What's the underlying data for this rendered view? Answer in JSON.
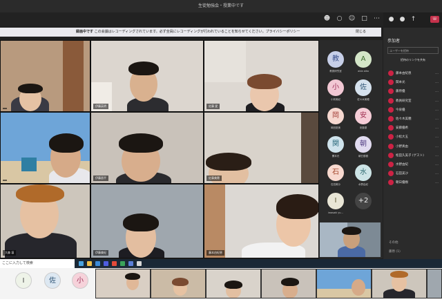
{
  "window": {
    "title": "生徒勉強会・授業中です"
  },
  "banner": {
    "warning": "録画中です",
    "text": "この会議はレコーディングされています。必ず全員にレコーディングが行われていることを知らせてください。プライバシーポリシー",
    "dismiss": "閉じる"
  },
  "tiles": [
    {
      "name": ""
    },
    {
      "name": "伊藤英明"
    },
    {
      "name": "佐藤 愛"
    },
    {
      "name": ""
    },
    {
      "name": "伊藤昌平"
    },
    {
      "name": "佐藤美穂"
    },
    {
      "name": "大森 凛"
    },
    {
      "name": "伊藤美紀"
    },
    {
      "name": "藤本由紀恵"
    }
  ],
  "avatars": [
    {
      "initial": "教",
      "label": "教員研究室",
      "bg": "#c7cfe8",
      "fg": "#384e8a"
    },
    {
      "initial": "A",
      "label": "aida aiko",
      "bg": "#d4e6c8",
      "fg": "#3b6b2b"
    },
    {
      "initial": "小",
      "label": "小林美紀",
      "bg": "#f2c8d4",
      "fg": "#9a2d55"
    },
    {
      "initial": "佐",
      "label": "佐々木美穂",
      "bg": "#d6e2ee",
      "fg": "#2f5576"
    },
    {
      "initial": "岡",
      "label": "岡田夏美",
      "bg": "#f6d8d0",
      "fg": "#a4413a"
    },
    {
      "initial": "安",
      "label": "安藤優",
      "bg": "#f6cdd7",
      "fg": "#a03052"
    },
    {
      "initial": "関",
      "label": "関本光",
      "bg": "#cfe3ec",
      "fg": "#2b6a7c"
    },
    {
      "initial": "朝",
      "label": "朝日優樹",
      "bg": "#e1dbf0",
      "fg": "#544085"
    },
    {
      "initial": "石",
      "label": "石田美沙",
      "bg": "#f8d9cf",
      "fg": "#a5492e"
    },
    {
      "initial": "水",
      "label": "水野由紀",
      "bg": "#cde4e6",
      "fg": "#2e6a70"
    },
    {
      "initial": "I",
      "label": "iwasaki yu...",
      "bg": "#e9e6d6",
      "fg": "#5a5430"
    },
    {
      "initial": "+2",
      "label": "",
      "bg": "#444444",
      "fg": "#eeeeee"
    }
  ],
  "sidebar": {
    "title": "参加者",
    "invite_placeholder": "ユーザーを招待",
    "share_label": "招待のリンクを共有",
    "participants": [
      "藤本由紀恵",
      "関本光",
      "藤原優",
      "教員研究室",
      "今泉優",
      "佐々木美穂",
      "安藤優希",
      "小松大五",
      "小野真由",
      "松田久美子 (ゲスト)",
      "水野由紀",
      "石田美沙",
      "朝日優樹"
    ],
    "section_label": "その他",
    "bottom_label": "藤原 (1)"
  },
  "taskbar": {
    "search_placeholder": "ここに入力して検索"
  },
  "strip": {
    "avatars": [
      {
        "initial": "I",
        "bg": "#eef3e8",
        "fg": "#444444"
      },
      {
        "initial": "佐",
        "bg": "#dde8f2",
        "fg": "#2f5576"
      },
      {
        "initial": "小",
        "bg": "#f6d2da",
        "fg": "#9a2d55"
      }
    ]
  }
}
